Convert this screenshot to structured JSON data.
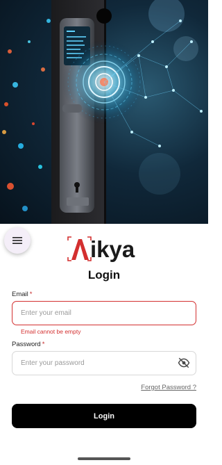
{
  "menu": {
    "icon": "hamburger-menu-icon"
  },
  "brand": {
    "logo_text": "ikya",
    "logo_mark": "A",
    "accent": "#d32f2f"
  },
  "login": {
    "title": "Login",
    "email": {
      "label": "Email",
      "required_mark": "*",
      "placeholder": "Enter your email",
      "value": "",
      "error": "Email cannot be empty"
    },
    "password": {
      "label": "Password",
      "required_mark": "*",
      "placeholder": "Enter your password",
      "value": "",
      "visibility_icon": "eye-off-icon"
    },
    "forgot_label": "Forgot Password ?",
    "submit_label": "Login"
  }
}
